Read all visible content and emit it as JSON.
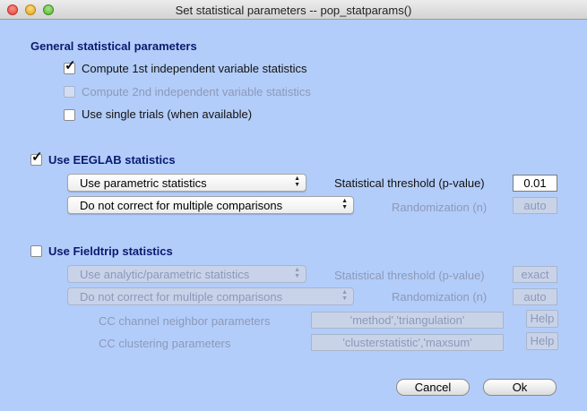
{
  "window": {
    "title": "Set statistical parameters -- pop_statparams()"
  },
  "general": {
    "heading": "General statistical parameters",
    "cb1": "Compute 1st independent variable statistics",
    "cb2": "Compute 2nd independent variable statistics",
    "cb3": "Use single trials (when available)"
  },
  "eeglab": {
    "heading": "Use EEGLAB statistics",
    "method": "Use parametric statistics",
    "correction": "Do not correct for multiple comparisons",
    "threshold_label": "Statistical threshold (p-value)",
    "threshold_value": "0.01",
    "randomization_label": "Randomization (n)",
    "randomization_value": "auto"
  },
  "fieldtrip": {
    "heading": "Use Fieldtrip statistics",
    "method": "Use analytic/parametric statistics",
    "correction": "Do not correct for multiple comparisons",
    "threshold_label": "Statistical threshold (p-value)",
    "threshold_value": "exact",
    "randomization_label": "Randomization (n)",
    "randomization_value": "auto",
    "neighbor_label": "CC channel neighbor parameters",
    "neighbor_value": "'method','triangulation'",
    "cluster_label": "CC clustering parameters",
    "cluster_value": "'clusterstatistic','maxsum'",
    "help_label": "Help"
  },
  "buttons": {
    "cancel": "Cancel",
    "ok": "Ok"
  },
  "icons": {
    "check": "✓",
    "popup_arrows": "▲▼"
  }
}
